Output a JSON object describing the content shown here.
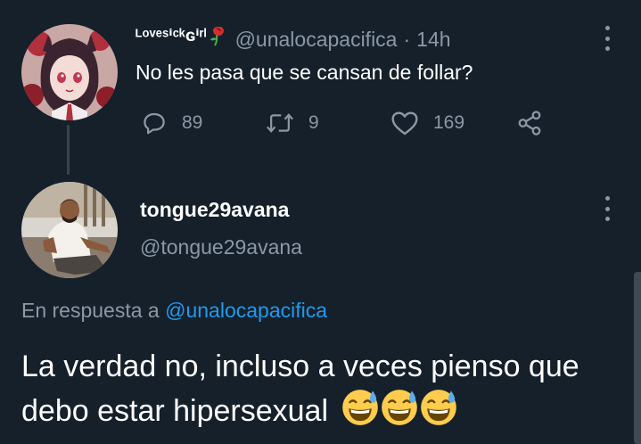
{
  "parent_tweet": {
    "display_name": "ᴸᵒᵛᵉˢⁱᶜᵏɢⁱʳˡ",
    "name_emoji_icon": "wilted-rose-icon",
    "handle": "@unalocapacifica",
    "separator": "·",
    "time": "14h",
    "text": "No les pasa que se cansan de follar?",
    "actions": {
      "reply_icon": "reply-bubble-icon",
      "reply_count": "89",
      "retweet_icon": "retweet-icon",
      "retweet_count": "9",
      "like_icon": "heart-icon",
      "like_count": "169",
      "share_icon": "share-icon"
    }
  },
  "main_tweet": {
    "display_name": "tongue29avana",
    "handle": "@tongue29avana",
    "reply_prefix": "En respuesta a",
    "reply_mention": "@unalocapacifica",
    "text": "La verdad no, incluso a veces pienso que debo estar hipersexual",
    "emoji_icon": "grinning-sweat-face-icon",
    "emoji_count": 3
  },
  "icons": {
    "more": "more-vertical-icon"
  },
  "colors": {
    "background": "#15202b",
    "text_primary": "#ffffff",
    "text_secondary": "#8b98a5",
    "accent": "#1d9bf0",
    "divider": "#38444d"
  }
}
